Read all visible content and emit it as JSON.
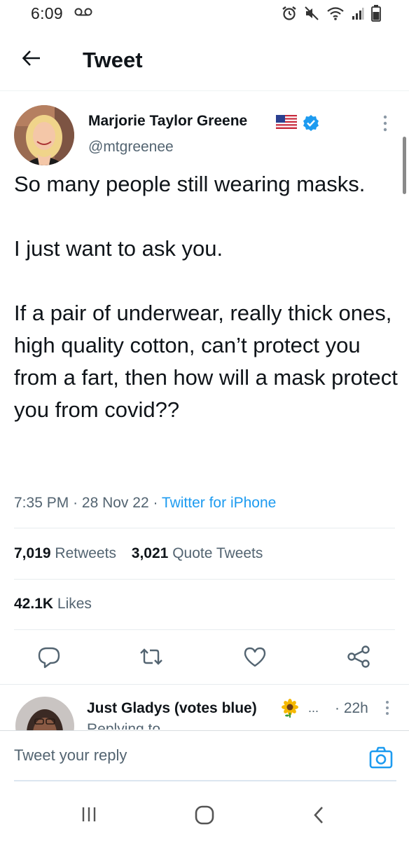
{
  "status_bar": {
    "time": "6:09"
  },
  "header": {
    "title": "Tweet"
  },
  "tweet": {
    "author": {
      "name": "Marjorie Taylor Greene",
      "handle": "@mtgreenee",
      "verified": true
    },
    "text_paragraphs": [
      "So many people still wearing masks.",
      "I just want to ask you.",
      "If a pair of underwear, really thick ones, high quality cotton, can’t protect you from a fart, then how will a mask protect you from covid??"
    ],
    "time": "7:35 PM",
    "date": "28 Nov 22",
    "source": "Twitter for iPhone",
    "retweets_count": "7,019",
    "retweets_label": "Retweets",
    "quotes_count": "3,021",
    "quotes_label": "Quote Tweets",
    "likes_count": "42.1K",
    "likes_label": "Likes"
  },
  "reply_preview": {
    "name": "Just Gladys (votes blue)",
    "ellipsis": "...",
    "time": "· 22h",
    "partial_text": "Replying to @mtgreenee"
  },
  "compose": {
    "placeholder": "Tweet your reply"
  },
  "colors": {
    "accent": "#1d9bf0",
    "text_primary": "#0f1419",
    "text_secondary": "#536471"
  },
  "icons": {
    "back": "arrow-left-icon",
    "verified": "verified-badge-icon",
    "more": "more-vertical-icon",
    "reply": "reply-icon",
    "retweet": "retweet-icon",
    "like": "heart-icon",
    "share": "share-icon",
    "camera": "camera-icon"
  }
}
